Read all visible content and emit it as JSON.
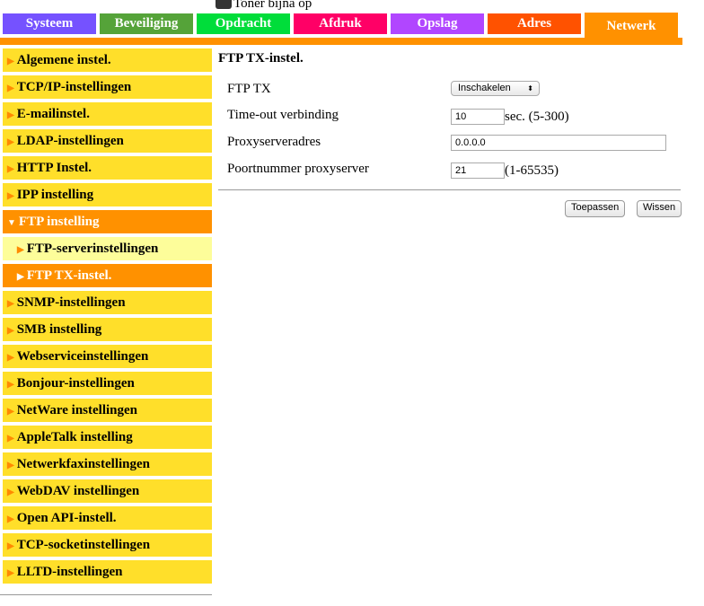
{
  "status": {
    "text": "Toner bijna op"
  },
  "tabs": [
    {
      "label": "Systeem",
      "color": "#7552ff"
    },
    {
      "label": "Beveiliging",
      "color": "#55a339"
    },
    {
      "label": "Opdracht",
      "color": "#00dd3a"
    },
    {
      "label": "Afdruk",
      "color": "#ff0066"
    },
    {
      "label": "Opslag",
      "color": "#b146ff"
    },
    {
      "label": "Adres",
      "color": "#ff5200"
    },
    {
      "label": "Netwerk",
      "color": "#ff9100",
      "active": true
    }
  ],
  "sidebar": [
    "Algemene instel.",
    "TCP/IP-instellingen",
    "E-mailinstel.",
    "LDAP-instellingen",
    "HTTP Instel.",
    "IPP instelling",
    "FTP instelling",
    "FTP-serverinstellingen",
    "FTP TX-instel.",
    "SNMP-instellingen",
    "SMB instelling",
    "Webserviceinstellingen",
    "Bonjour-instellingen",
    "NetWare instellingen",
    "AppleTalk instelling",
    "Netwerkfaxinstellingen",
    "WebDAV instellingen",
    "Open API-instell.",
    "TCP-socketinstellingen",
    "LLTD-instellingen"
  ],
  "main": {
    "title": "FTP TX-instel.",
    "ftp_tx": {
      "label": "FTP TX",
      "value": "Inschakelen"
    },
    "timeout": {
      "label": "Time-out verbinding",
      "value": "10",
      "hint": "sec. (5-300)"
    },
    "proxy": {
      "label": "Proxyserveradres",
      "value": "0.0.0.0"
    },
    "port": {
      "label": "Poortnummer proxyserver",
      "value": "21",
      "hint": "(1-65535)"
    },
    "apply": "Toepassen",
    "clear": "Wissen"
  }
}
